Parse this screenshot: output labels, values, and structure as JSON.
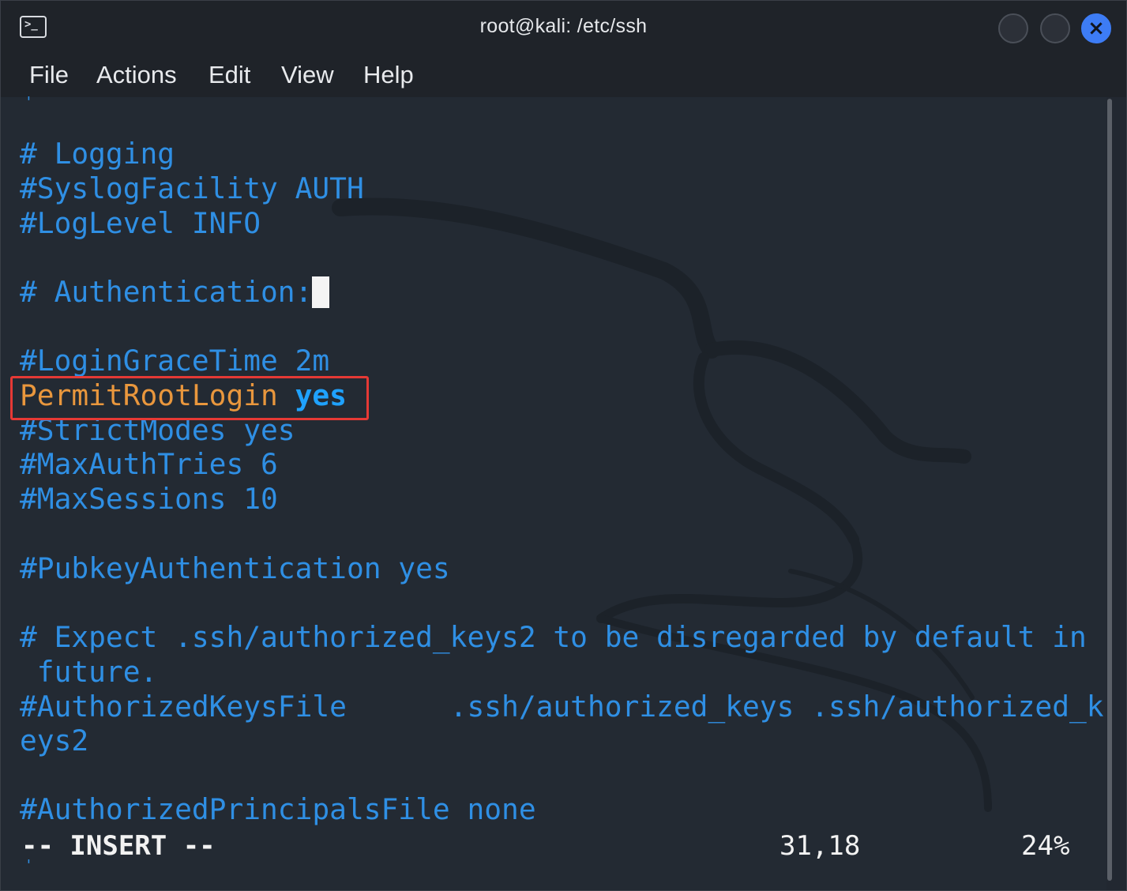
{
  "window": {
    "title": "root@kali: /etc/ssh"
  },
  "menu": {
    "items": [
      "File",
      "Actions",
      "Edit",
      "View",
      "Help"
    ]
  },
  "editor": {
    "lines": {
      "logging_comment": "# Logging",
      "syslog": "#SyslogFacility AUTH",
      "loglevel": "#LogLevel INFO",
      "auth_comment": "# Authentication:",
      "logingrace": "#LoginGraceTime 2m",
      "permitroot_key": "PermitRootLogin",
      "permitroot_val": "yes",
      "strictmodes": "#StrictModes yes",
      "maxauth": "#MaxAuthTries 6",
      "maxsessions": "#MaxSessions 10",
      "pubkey": "#PubkeyAuthentication yes",
      "expect_1": "# Expect .ssh/authorized_keys2 to be disregarded by default in",
      "expect_2": " future.",
      "authkeys_1": "#AuthorizedKeysFile      .ssh/authorized_keys .ssh/authorized_k",
      "authkeys_2": "eys2",
      "principals": "#AuthorizedPrincipalsFile none"
    },
    "status": {
      "mode": "-- INSERT --",
      "position": "31,18",
      "percent": "24%"
    }
  },
  "colors": {
    "comment": "#2f8fe4",
    "keyword": "#e9973d",
    "value": "#1fa2ff",
    "highlight": "#e53935",
    "close_button": "#3d7cf5"
  },
  "icons": [
    "terminal-icon",
    "minimize-icon",
    "maximize-icon",
    "close-icon"
  ]
}
